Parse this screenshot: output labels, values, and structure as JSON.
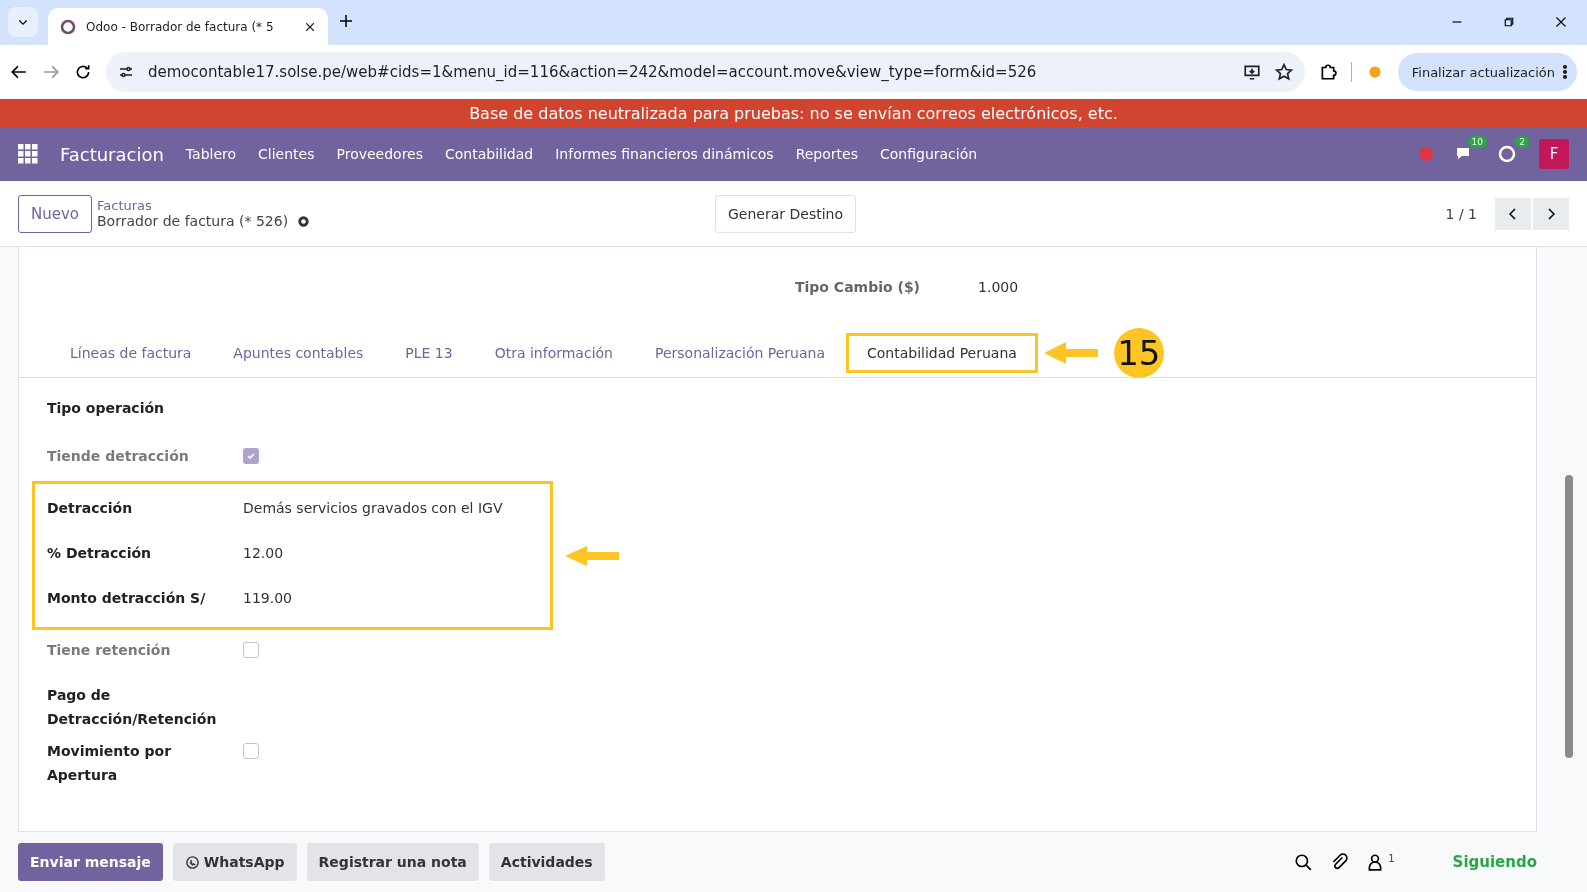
{
  "browser": {
    "tab_title": "Odoo - Borrador de factura (* 5",
    "url": "democontable17.solse.pe/web#cids=1&menu_id=116&action=242&model=account.move&view_type=form&id=526",
    "update_button": "Finalizar actualización"
  },
  "banner": "Base de datos neutralizada para pruebas: no se envían correos electrónicos, etc.",
  "navbar": {
    "app_name": "Facturacion",
    "menu": [
      "Tablero",
      "Clientes",
      "Proveedores",
      "Contabilidad",
      "Informes financieros dinámicos",
      "Reportes",
      "Configuración"
    ],
    "messages_count": "10",
    "activities_count": "2",
    "avatar": "F"
  },
  "control_panel": {
    "new_button": "Nuevo",
    "breadcrumb": "Facturas",
    "record": "Borrador de factura (* 526)",
    "action_button": "Generar Destino",
    "pager": "1 / 1"
  },
  "form": {
    "exchange": {
      "label": "Tipo Cambio ($)",
      "value": "1.000"
    },
    "tabs": [
      {
        "label": "Líneas de factura",
        "selected": false
      },
      {
        "label": "Apuntes contables",
        "selected": false
      },
      {
        "label": "PLE 13",
        "selected": false
      },
      {
        "label": "Otra información",
        "selected": false
      },
      {
        "label": "Personalización Peruana",
        "selected": false
      },
      {
        "label": "Contabilidad Peruana",
        "selected": true
      }
    ],
    "step_number": "15",
    "section_title": "Tipo operación",
    "fields": [
      {
        "kind": "checkbox",
        "label": "Tiende detracción",
        "checked": true,
        "disabled": true,
        "highlighted": false
      },
      {
        "kind": "text",
        "label": "Detracción",
        "value": "Demás servicios gravados con el IGV",
        "highlighted": true
      },
      {
        "kind": "text",
        "label": "% Detracción",
        "value": "12.00",
        "highlighted": true
      },
      {
        "kind": "text",
        "label": "Monto detracción S/",
        "value": "119.00",
        "highlighted": true
      },
      {
        "kind": "checkbox",
        "label": "Tiene retención",
        "checked": false,
        "disabled": true,
        "highlighted": false
      },
      {
        "kind": "text",
        "label": "Pago de Detracción/Retención",
        "highlighted": false
      },
      {
        "kind": "checkbox",
        "label": "Movimiento por Apertura",
        "checked": false,
        "disabled": false,
        "highlighted": false
      }
    ]
  },
  "chatter": {
    "buttons": [
      {
        "label": "Enviar mensaje",
        "primary": true
      },
      {
        "label": "WhatsApp",
        "primary": false
      },
      {
        "label": "Registrar una nota",
        "primary": false
      },
      {
        "label": "Actividades",
        "primary": false
      }
    ],
    "follower_count": "1",
    "follow_status": "Siguiendo"
  }
}
